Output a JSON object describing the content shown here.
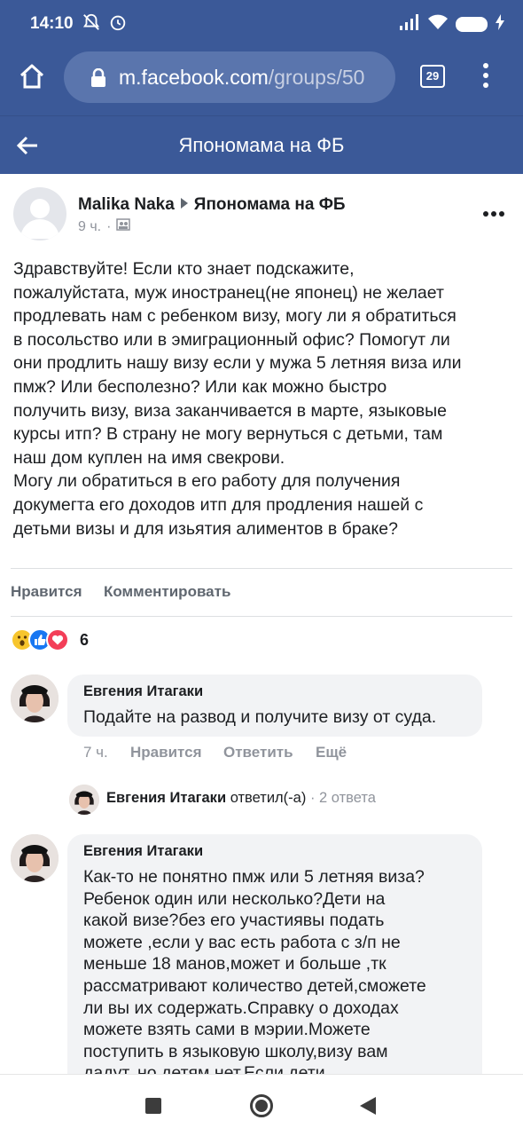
{
  "status_bar": {
    "time": "14:10",
    "battery": "35",
    "color": "#3b5998"
  },
  "browser": {
    "url_main": "m.facebook.com",
    "url_rest": "/groups/50",
    "tab_count": "29",
    "icons": [
      "home-icon",
      "lock-icon",
      "menu-dots-icon"
    ]
  },
  "group_header": {
    "title": "Япономама на ФБ"
  },
  "post": {
    "author": "Malika Naka",
    "group": "Япономама на ФБ",
    "time": "9 ч.",
    "text": "Здравствуйте! Если кто знает подскажите,\nпожалуйстата, муж иностранец(не японец) не желает\nпродлевать нам с ребенком визу, могу ли я обратиться\nв посольство или в эмиграционный офис? Помогут ли\nони продлить нашу визу если у мужа 5 летняя виза или\nпмж? Или бесполезно? Или как можно быстро\nполучить визу, виза заканчивается в марте, языковые\nкурсы итп? В страну не могу вернуться с детьми, там\nнаш дом куплен на имя свекрови.\nМогу ли обратиться в его работу для получения\nдокумегта его доходов итп для продления нашей с\nдетьми визы и для изьятия алиментов в браке?",
    "like_label": "Нравится",
    "comment_label": "Комментировать",
    "reaction_count": "6"
  },
  "comments": [
    {
      "name": "Евгения Итагаки",
      "text": "Подайте на развод и получите визу от суда.",
      "time": "7 ч.",
      "like_label": "Нравится",
      "reply_label": "Ответить",
      "more_label": "Ещё"
    },
    {
      "name": "Евгения Итагаки",
      "text": "Как-то не понятно пмж или 5 летняя виза?\nРебенок один или несколько?Дети на\nкакой визе?без его участиявы подать\nможете ,если у вас есть работа с з/п не\nменьше 18 манов,может и больше ,тк\nрассматривают количество детей,сможете\nли вы их содержать.Справку о доходах\nможете взять сами в мэрии.Можете\nпоступить в языковую школу,визу вам\nдадут, но детям нет.Если дети"
    }
  ],
  "reply_summary": {
    "name": "Евгения Итагаки",
    "verb": "ответил(-а)",
    "count": "· 2 ответа"
  }
}
